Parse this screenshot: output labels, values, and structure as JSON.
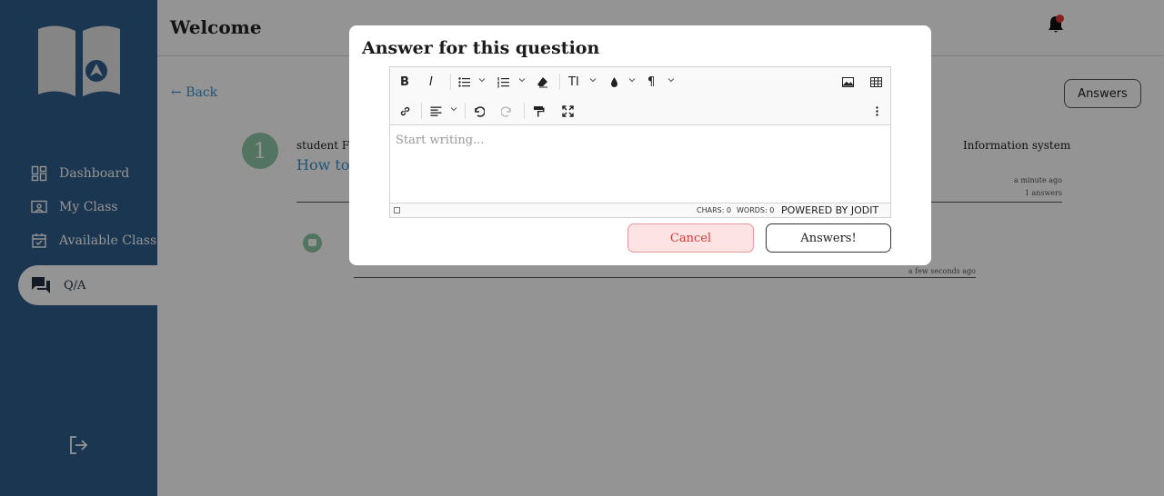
{
  "header": {
    "title": "Welcome"
  },
  "colors": {
    "sidebar": "#2f5d8a",
    "accent": "#3a90c9",
    "green": "#8fc9a8",
    "danger": "#d23b3b"
  },
  "sidebar": {
    "items": [
      {
        "label": "Dashboard",
        "icon": "dashboard-icon"
      },
      {
        "label": "My Class",
        "icon": "class-icon"
      },
      {
        "label": "Available Class",
        "icon": "calendar-icon"
      },
      {
        "label": "Q/A",
        "icon": "chat-icon",
        "active": true
      }
    ]
  },
  "main": {
    "back_label": "Back",
    "answers_label": "Answers",
    "question": {
      "number": "1",
      "author": "student Fr",
      "title": "How to",
      "category": "Information system",
      "time": "a minute ago",
      "answer_count": "1 answers"
    },
    "answer": {
      "time": "a few seconds ago"
    }
  },
  "modal": {
    "title": "Answer for this question",
    "editor": {
      "placeholder": "Start writing...",
      "font_button": "TI",
      "chars_label": "CHARS: 0",
      "words_label": "WORDS: 0",
      "powered_by": "POWERED BY JODIT"
    },
    "cancel_label": "Cancel",
    "submit_label": "Answers!"
  }
}
